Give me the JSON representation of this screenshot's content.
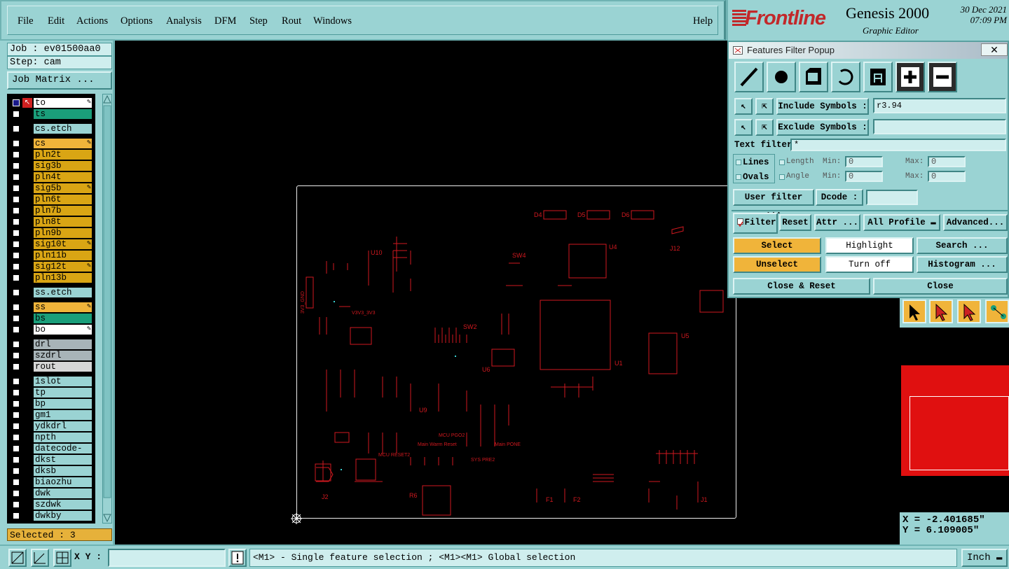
{
  "menu": {
    "file": "File",
    "edit": "Edit",
    "actions": "Actions",
    "options": "Options",
    "analysis": "Analysis",
    "dfm": "DFM",
    "step": "Step",
    "rout": "Rout",
    "windows": "Windows",
    "help": "Help"
  },
  "logo": {
    "brand": "Frontline",
    "product": "Genesis 2000",
    "subtitle": "Graphic Editor",
    "date": "30 Dec 2021",
    "time": "07:09 PM"
  },
  "job": {
    "job_line": "Job : ev01500aa0",
    "step_line": "Step: cam",
    "matrix_button": "Job Matrix ..."
  },
  "layers": [
    {
      "name": "to",
      "color": "#ffffff",
      "pen": true,
      "group": 0
    },
    {
      "name": "ts",
      "color": "#1a9e7a",
      "pen": false,
      "group": 0
    },
    {
      "name": "cs.etch",
      "color": "#9ad3d3",
      "pen": false,
      "group": 1
    },
    {
      "name": "cs",
      "color": "#f0b43a",
      "pen": true,
      "group": 2
    },
    {
      "name": "pln2t",
      "color": "#d9a514",
      "pen": false,
      "group": 2
    },
    {
      "name": "sig3b",
      "color": "#d9a514",
      "pen": false,
      "group": 2
    },
    {
      "name": "pln4t",
      "color": "#d9a514",
      "pen": false,
      "group": 2
    },
    {
      "name": "sig5b",
      "color": "#d9a514",
      "pen": true,
      "group": 2
    },
    {
      "name": "pln6t",
      "color": "#d9a514",
      "pen": false,
      "group": 2
    },
    {
      "name": "pln7b",
      "color": "#d9a514",
      "pen": false,
      "group": 2
    },
    {
      "name": "pln8t",
      "color": "#d9a514",
      "pen": false,
      "group": 2
    },
    {
      "name": "pln9b",
      "color": "#d9a514",
      "pen": false,
      "group": 2
    },
    {
      "name": "sig10t",
      "color": "#d9a514",
      "pen": true,
      "group": 2
    },
    {
      "name": "pln11b",
      "color": "#d9a514",
      "pen": false,
      "group": 2
    },
    {
      "name": "sig12t",
      "color": "#d9a514",
      "pen": true,
      "group": 2
    },
    {
      "name": "pln13b",
      "color": "#d9a514",
      "pen": false,
      "group": 2
    },
    {
      "name": "ss.etch",
      "color": "#9ad3d3",
      "pen": false,
      "group": 3
    },
    {
      "name": "ss",
      "color": "#f0b43a",
      "pen": true,
      "group": 4
    },
    {
      "name": "bs",
      "color": "#1a9e7a",
      "pen": false,
      "group": 4
    },
    {
      "name": "bo",
      "color": "#ffffff",
      "pen": true,
      "group": 4
    },
    {
      "name": "drl",
      "color": "#a8b4b8",
      "pen": false,
      "group": 5
    },
    {
      "name": "szdrl",
      "color": "#a8b4b8",
      "pen": false,
      "group": 5
    },
    {
      "name": "rout",
      "color": "#d6d6d6",
      "pen": false,
      "group": 5
    },
    {
      "name": "1slot",
      "color": "#9ad3d3",
      "pen": false,
      "group": 6
    },
    {
      "name": "tp",
      "color": "#9ad3d3",
      "pen": false,
      "group": 6
    },
    {
      "name": "bp",
      "color": "#9ad3d3",
      "pen": false,
      "group": 6
    },
    {
      "name": "gm1",
      "color": "#9ad3d3",
      "pen": false,
      "group": 6
    },
    {
      "name": "ydkdrl",
      "color": "#9ad3d3",
      "pen": false,
      "group": 6
    },
    {
      "name": "npth",
      "color": "#9ad3d3",
      "pen": false,
      "group": 6
    },
    {
      "name": "datecode-bs",
      "color": "#9ad3d3",
      "pen": false,
      "group": 6
    },
    {
      "name": "dkst",
      "color": "#9ad3d3",
      "pen": false,
      "group": 6
    },
    {
      "name": "dksb",
      "color": "#9ad3d3",
      "pen": false,
      "group": 6
    },
    {
      "name": "biaozhu",
      "color": "#9ad3d3",
      "pen": false,
      "group": 6
    },
    {
      "name": "dwk",
      "color": "#9ad3d3",
      "pen": false,
      "group": 6
    },
    {
      "name": "szdwk",
      "color": "#9ad3d3",
      "pen": false,
      "group": 6
    },
    {
      "name": "dwkby",
      "color": "#9ad3d3",
      "pen": false,
      "group": 6
    }
  ],
  "selected": "Selected : 3",
  "bottom": {
    "xy_label": "X Y :",
    "xy_value": "",
    "status": "<M1> - Single feature selection ; <M1><M1> Global selection",
    "units": "Inch"
  },
  "popup": {
    "title": "Features Filter Popup",
    "include_label": "Include Symbols :",
    "include_value": "r3.94",
    "exclude_label": "Exclude Symbols :",
    "exclude_value": "",
    "text_filter_label": "Text filter",
    "text_filter_value": "*",
    "lines": "Lines",
    "ovals": "Ovals",
    "length": "Length",
    "angle": "Angle",
    "min": "Min:",
    "max": "Max:",
    "min_len": "0",
    "max_len": "0",
    "min_ang": "0",
    "max_ang": "0",
    "user_filter": "User filter ...",
    "dcode": "Dcode :",
    "dcode_value": "",
    "filter": "Filter",
    "reset": "Reset",
    "attr": "Attr ...",
    "all_profile": "All Profile",
    "advanced": "Advanced...",
    "select": "Select",
    "highlight": "Highlight",
    "search": "Search ...",
    "unselect": "Unselect",
    "turn_off": "Turn off",
    "histogram": "Histogram ...",
    "close_reset": "Close & Reset",
    "close": "Close"
  },
  "coords": {
    "x": "X = -2.401685\"",
    "y": "Y = 6.109005\""
  },
  "board_labels": {
    "u10": "U10",
    "sw4": "SW4",
    "u4": "U4",
    "j12": "J12",
    "u5": "U5",
    "u1": "U1",
    "u6": "U6",
    "sw2": "SW2",
    "u9": "U9",
    "j2": "J2",
    "r6": "R6",
    "f1": "F1",
    "f2": "F2",
    "j1": "J1",
    "d4": "D4",
    "d5": "D5",
    "d6": "D6",
    "v3v3": "V3V3_3V3",
    "gnd": "3V3_GND",
    "mcu_reset": "MCU RESET2",
    "main_warm": "Main Warm Reset",
    "main_pone": "Main PONE",
    "mcu_pgo2": "MCU PGO2",
    "sys_pre2": "SYS PRE2"
  },
  "colors": {
    "panel": "#9ad3d3",
    "board_red": "#d0191f",
    "accent_orange": "#f0b43a"
  }
}
